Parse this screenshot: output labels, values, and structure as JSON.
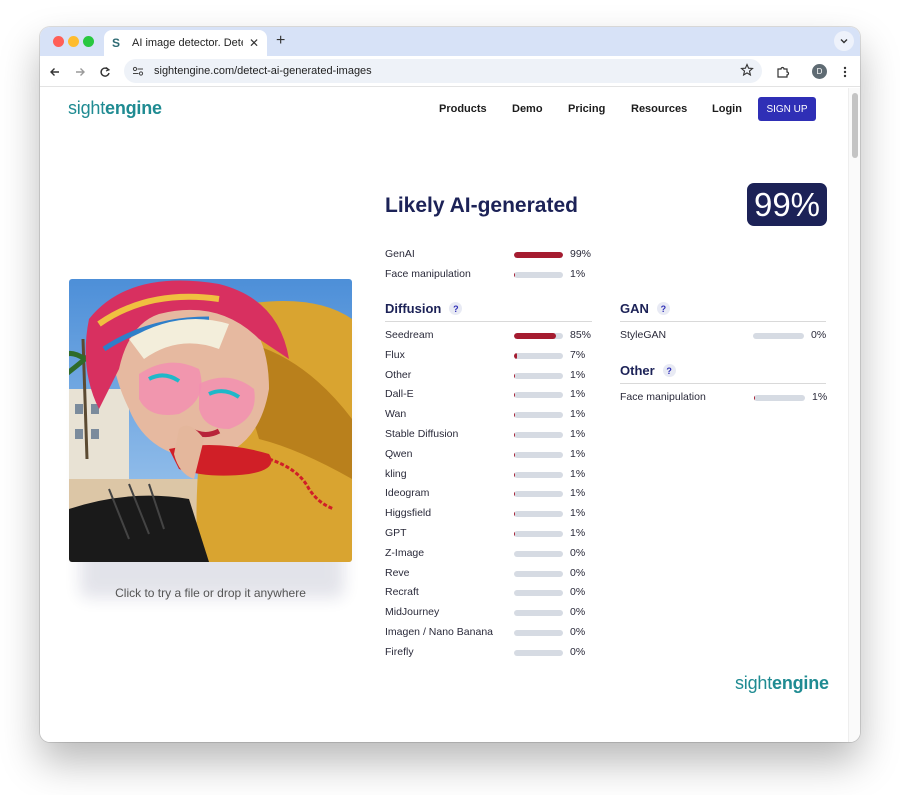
{
  "browser": {
    "tab_title": "AI image detector. Detect AI-",
    "tab_favicon": "S",
    "tab_close": "✕",
    "new_tab": "+",
    "url": "sightengine.com/detect-ai-generated-images",
    "profile_initial": "D"
  },
  "site": {
    "logo_light": "sight",
    "logo_bold": "engine",
    "nav": [
      "Products",
      "Demo",
      "Pricing",
      "Resources",
      "Login"
    ],
    "signup": "SIGN UP"
  },
  "result": {
    "verdict": "Likely AI-generated",
    "score": "99%",
    "summary": [
      {
        "label": "GenAI",
        "pct": "99%",
        "value": 0.99
      },
      {
        "label": "Face manipulation",
        "pct": "1%",
        "value": 0.01
      }
    ]
  },
  "diffusion": {
    "title": "Diffusion",
    "help": "?",
    "items": [
      {
        "label": "Seedream",
        "pct": "85%",
        "value": 0.85
      },
      {
        "label": "Flux",
        "pct": "7%",
        "value": 0.07
      },
      {
        "label": "Other",
        "pct": "1%",
        "value": 0.01
      },
      {
        "label": "Dall-E",
        "pct": "1%",
        "value": 0.01
      },
      {
        "label": "Wan",
        "pct": "1%",
        "value": 0.01
      },
      {
        "label": "Stable Diffusion",
        "pct": "1%",
        "value": 0.01
      },
      {
        "label": "Qwen",
        "pct": "1%",
        "value": 0.01
      },
      {
        "label": "kling",
        "pct": "1%",
        "value": 0.01
      },
      {
        "label": "Ideogram",
        "pct": "1%",
        "value": 0.01
      },
      {
        "label": "Higgsfield",
        "pct": "1%",
        "value": 0.01
      },
      {
        "label": "GPT",
        "pct": "1%",
        "value": 0.01
      },
      {
        "label": "Z-Image",
        "pct": "0%",
        "value": 0.0
      },
      {
        "label": "Reve",
        "pct": "0%",
        "value": 0.0
      },
      {
        "label": "Recraft",
        "pct": "0%",
        "value": 0.0
      },
      {
        "label": "MidJourney",
        "pct": "0%",
        "value": 0.0
      },
      {
        "label": "Imagen / Nano Banana",
        "pct": "0%",
        "value": 0.0
      },
      {
        "label": "Firefly",
        "pct": "0%",
        "value": 0.0
      }
    ]
  },
  "gan": {
    "title": "GAN",
    "help": "?",
    "items": [
      {
        "label": "StyleGAN",
        "pct": "0%",
        "value": 0.0
      }
    ]
  },
  "other": {
    "title": "Other",
    "help": "?",
    "items": [
      {
        "label": "Face manipulation",
        "pct": "1%",
        "value": 0.01
      }
    ]
  },
  "upload": {
    "caption": "Click to try a file or drop it anywhere"
  },
  "colors": {
    "accent": "#2f2fb6",
    "navy": "#1c2257",
    "bar_fill": "#a51c30",
    "bar_track": "#d6dbe3",
    "logo": "#1f8b92"
  }
}
